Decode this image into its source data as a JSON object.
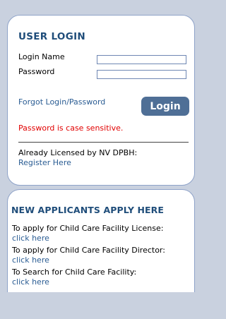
{
  "login": {
    "heading": "USER LOGIN",
    "login_name_label": "Login Name",
    "password_label": "Password",
    "login_name_value": "",
    "password_value": "",
    "forgot_link": "Forgot Login/Password",
    "login_button": "Login",
    "password_note": "Password is case sensitive.",
    "already_licensed": "Already Licensed by NV DPBH:",
    "register_link": "Register Here"
  },
  "applicants": {
    "heading": "NEW APPLICANTS APPLY HERE",
    "items": [
      {
        "text": "To apply for Child Care Facility License:",
        "link": "click here"
      },
      {
        "text": "To apply for Child Care Facility Director:",
        "link": "click here"
      },
      {
        "text": "To Search for Child Care Facility:",
        "link": "click here"
      }
    ]
  },
  "colors": {
    "background": "#c9d1df",
    "panel_border": "#8ea2c8",
    "heading": "#1f4d7a",
    "link": "#2a5c93",
    "button": "#4f6f96",
    "warning": "#e10000"
  }
}
